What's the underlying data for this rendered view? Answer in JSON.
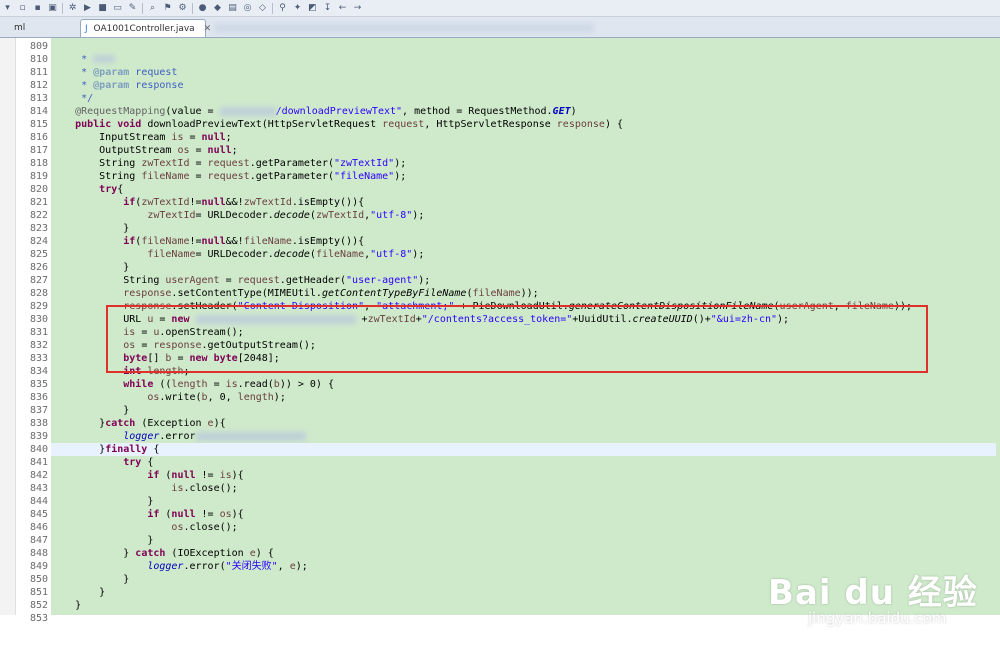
{
  "tabs": {
    "xml_tab_label": "ml",
    "active_tab_label": "OA1001Controller.java",
    "active_tab_close": "✕"
  },
  "toolbar": {
    "icons": [
      "menu-icon",
      "new-icon",
      "save-icon",
      "save-all-icon",
      "debug-icon",
      "run-icon",
      "stop-icon",
      "terminal-icon",
      "tools-icon",
      "search-icon",
      "bookmark-icon",
      "gear-icon",
      "run-launch-icon",
      "ext-tools-icon",
      "new-package-icon",
      "new-class-icon",
      "open-type-icon",
      "pin-icon",
      "annotation-icon",
      "highlight-icon",
      "next-icon",
      "back-icon",
      "forward-icon"
    ]
  },
  "editor": {
    "lines": [
      {
        "num": "809",
        "html": "     "
      },
      {
        "num": "810",
        "html": "     <span class=\"jdoc\">* </span><span class=\"blur\" style=\"width:22px;height:8px\"></span>"
      },
      {
        "num": "811",
        "html": "     <span class=\"jdoc\">* </span><span class=\"jtag\">@param</span><span class=\"jdoc\"> request</span>"
      },
      {
        "num": "812",
        "html": "     <span class=\"jdoc\">* </span><span class=\"jtag\">@param</span><span class=\"jdoc\"> response</span>"
      },
      {
        "num": "813",
        "html": "     <span class=\"jdoc\">*/</span>"
      },
      {
        "num": "814",
        "html": "    <span class=\"ann\">@RequestMapping</span>(value = <span class=\"blur\" style=\"width:56px;height:9px\"></span><span class=\"str\">/downloadPreviewText\"</span>, method = RequestMethod.<span class=\"fld it\"><b>GET</b></span>)"
      },
      {
        "num": "815",
        "html": "    <span class=\"kw\">public</span> <span class=\"kw\">void</span> downloadPreviewText(HttpServletRequest <span class=\"var\">request</span>, HttpServletResponse <span class=\"var\">response</span>) {"
      },
      {
        "num": "816",
        "html": "        InputStream <span class=\"var\">is</span> = <span class=\"kw\">null</span>;"
      },
      {
        "num": "817",
        "html": "        OutputStream <span class=\"var\">os</span> = <span class=\"kw\">null</span>;"
      },
      {
        "num": "818",
        "html": "        String <span class=\"var\">zwTextId</span> = <span class=\"var\">request</span>.getParameter(<span class=\"str\">\"zwTextId\"</span>);"
      },
      {
        "num": "819",
        "html": "        String <span class=\"var\">fileName</span> = <span class=\"var\">request</span>.getParameter(<span class=\"str\">\"fileName\"</span>);"
      },
      {
        "num": "820",
        "html": "        <span class=\"kw\">try</span>{"
      },
      {
        "num": "821",
        "html": "            <span class=\"kw\">if</span>(<span class=\"var\">zwTextId</span>!=<span class=\"kw\">null</span>&amp;&amp;!<span class=\"var\">zwTextId</span>.isEmpty()){"
      },
      {
        "num": "822",
        "html": "                <span class=\"var\">zwTextId</span>= URLDecoder.<span class=\"it\">decode</span>(<span class=\"var\">zwTextId</span>,<span class=\"str\">\"utf-8\"</span>);"
      },
      {
        "num": "823",
        "html": "            }"
      },
      {
        "num": "824",
        "html": "            <span class=\"kw\">if</span>(<span class=\"var\">fileName</span>!=<span class=\"kw\">null</span>&amp;&amp;!<span class=\"var\">fileName</span>.isEmpty()){"
      },
      {
        "num": "825",
        "html": "                <span class=\"var\">fileName</span>= URLDecoder.<span class=\"it\">decode</span>(<span class=\"var\">fileName</span>,<span class=\"str\">\"utf-8\"</span>);"
      },
      {
        "num": "826",
        "html": "            }"
      },
      {
        "num": "827",
        "html": "            String <span class=\"var\">userAgent</span> = <span class=\"var\">request</span>.getHeader(<span class=\"str\">\"user-agent\"</span>);"
      },
      {
        "num": "828",
        "html": "            <span class=\"var\">response</span>.setContentType(MIMEUtil.<span class=\"it\">getContentTypeByFileName</span>(<span class=\"var\">fileName</span>));"
      },
      {
        "num": "829",
        "html": "            <span class=\"var\">response</span>.setHeader(<span class=\"str\">\"Content-Disposition\"</span>, <span class=\"str\">\"attachment;\"</span> + PieDownloadUtil.<span class=\"it\">generateContentDispositionFileName</span>(<span class=\"var\">userAgent</span>, <span class=\"var\">fileName</span>));"
      },
      {
        "num": "830",
        "html": "            URL <span class=\"var\">u</span> = <span class=\"kw\">new</span> <span class=\"blur\" style=\"width:160px;height:9px\"></span> +<span class=\"var\">zwTextId</span>+<span class=\"str\">\"/contents?access_token=\"</span>+UuidUtil.<span class=\"it\">createUUID</span>()+<span class=\"str\">\"&amp;ui=zh-cn\"</span>);"
      },
      {
        "num": "831",
        "html": "            <span class=\"var\">is</span> = <span class=\"var\">u</span>.openStream();"
      },
      {
        "num": "832",
        "html": "            <span class=\"var\">os</span> = <span class=\"var\">response</span>.getOutputStream();"
      },
      {
        "num": "833",
        "html": "            <span class=\"kw\">byte</span>[] <span class=\"var\">b</span> = <span class=\"kw\">new</span> <span class=\"kw\">byte</span>[2048];"
      },
      {
        "num": "834",
        "html": "            <span class=\"kw\">int</span> <span class=\"var\">length</span>;"
      },
      {
        "num": "835",
        "html": "            <span class=\"kw\">while</span> ((<span class=\"var\">length</span> = <span class=\"var\">is</span>.read(<span class=\"var\">b</span>)) &gt; 0) {"
      },
      {
        "num": "836",
        "html": "                <span class=\"var\">os</span>.write(<span class=\"var\">b</span>, 0, <span class=\"var\">length</span>);"
      },
      {
        "num": "837",
        "html": "            }"
      },
      {
        "num": "838",
        "html": "        }<span class=\"kw\">catch</span> (Exception <span class=\"var\">e</span>){"
      },
      {
        "num": "839",
        "html": "            <span class=\"fld it\">logger</span>.error<span class=\"blur\" style=\"width:110px;height:9px\"></span>"
      },
      {
        "num": "840",
        "html": "        }<span class=\"kw\">finally</span> {",
        "current": true
      },
      {
        "num": "841",
        "html": "            <span class=\"kw\">try</span> {"
      },
      {
        "num": "842",
        "html": "                <span class=\"kw\">if</span> (<span class=\"kw\">null</span> != <span class=\"var\">is</span>){"
      },
      {
        "num": "843",
        "html": "                    <span class=\"var\">is</span>.close();"
      },
      {
        "num": "844",
        "html": "                }"
      },
      {
        "num": "845",
        "html": "                <span class=\"kw\">if</span> (<span class=\"kw\">null</span> != <span class=\"var\">os</span>){"
      },
      {
        "num": "846",
        "html": "                    <span class=\"var\">os</span>.close();"
      },
      {
        "num": "847",
        "html": "                }"
      },
      {
        "num": "848",
        "html": "            } <span class=\"kw\">catch</span> (IOException <span class=\"var\">e</span>) {"
      },
      {
        "num": "849",
        "html": "                <span class=\"fld it\">logger</span>.error(<span class=\"str\">\"关闭失败\"</span>, <span class=\"var\">e</span>);"
      },
      {
        "num": "850",
        "html": "            }"
      },
      {
        "num": "851",
        "html": "        }"
      },
      {
        "num": "852",
        "html": "    }"
      },
      {
        "num": "853",
        "html": ""
      }
    ]
  },
  "watermark": {
    "brand": "Bai du 经验",
    "domain": "jingyan.baidu.com"
  },
  "colors": {
    "code_background": "#cfeacb",
    "highlight_box": "#e0302b",
    "keyword": "#7f0055",
    "string": "#2a00ff"
  }
}
